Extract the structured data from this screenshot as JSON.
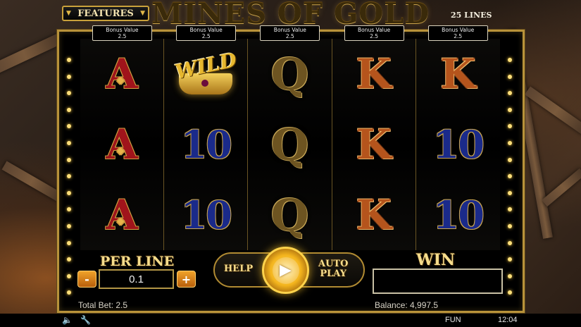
{
  "header": {
    "title": "MINES OF GOLD",
    "features_label": "FEATURES",
    "lines_label": "25 LINES"
  },
  "reels": [
    {
      "bonus_label": "Bonus Value",
      "bonus_value": "2.5",
      "symbols": [
        "A",
        "A",
        "A"
      ]
    },
    {
      "bonus_label": "Bonus Value",
      "bonus_value": "2.5",
      "symbols": [
        "WILD",
        "10",
        "10"
      ]
    },
    {
      "bonus_label": "Bonus Value",
      "bonus_value": "2.5",
      "symbols": [
        "Q",
        "Q",
        "Q"
      ]
    },
    {
      "bonus_label": "Bonus Value",
      "bonus_value": "2.5",
      "symbols": [
        "K",
        "K",
        "K"
      ]
    },
    {
      "bonus_label": "Bonus Value",
      "bonus_value": "2.5",
      "symbols": [
        "K",
        "10",
        "10"
      ]
    }
  ],
  "controls": {
    "per_line_label": "PER LINE",
    "per_line_value": "0.1",
    "minus_label": "-",
    "plus_label": "+",
    "help_label": "HELP",
    "auto_label_1": "AUTO",
    "auto_label_2": "PLAY",
    "spin_icon": "play-icon",
    "win_label": "WIN",
    "win_value": ""
  },
  "info": {
    "total_bet": "Total Bet: 2.5",
    "balance": "Balance: 4,997.5"
  },
  "status_bar": {
    "sound_icon": "speaker-icon",
    "settings_icon": "wrench-icon",
    "mode": "FUN",
    "time": "12:04"
  },
  "colors": {
    "gold": "#c9a13b",
    "ace_red": "#a0141b",
    "king_orange": "#b5541c",
    "ten_blue": "#1a2a8a",
    "spin_gold": "#f3b41d"
  }
}
